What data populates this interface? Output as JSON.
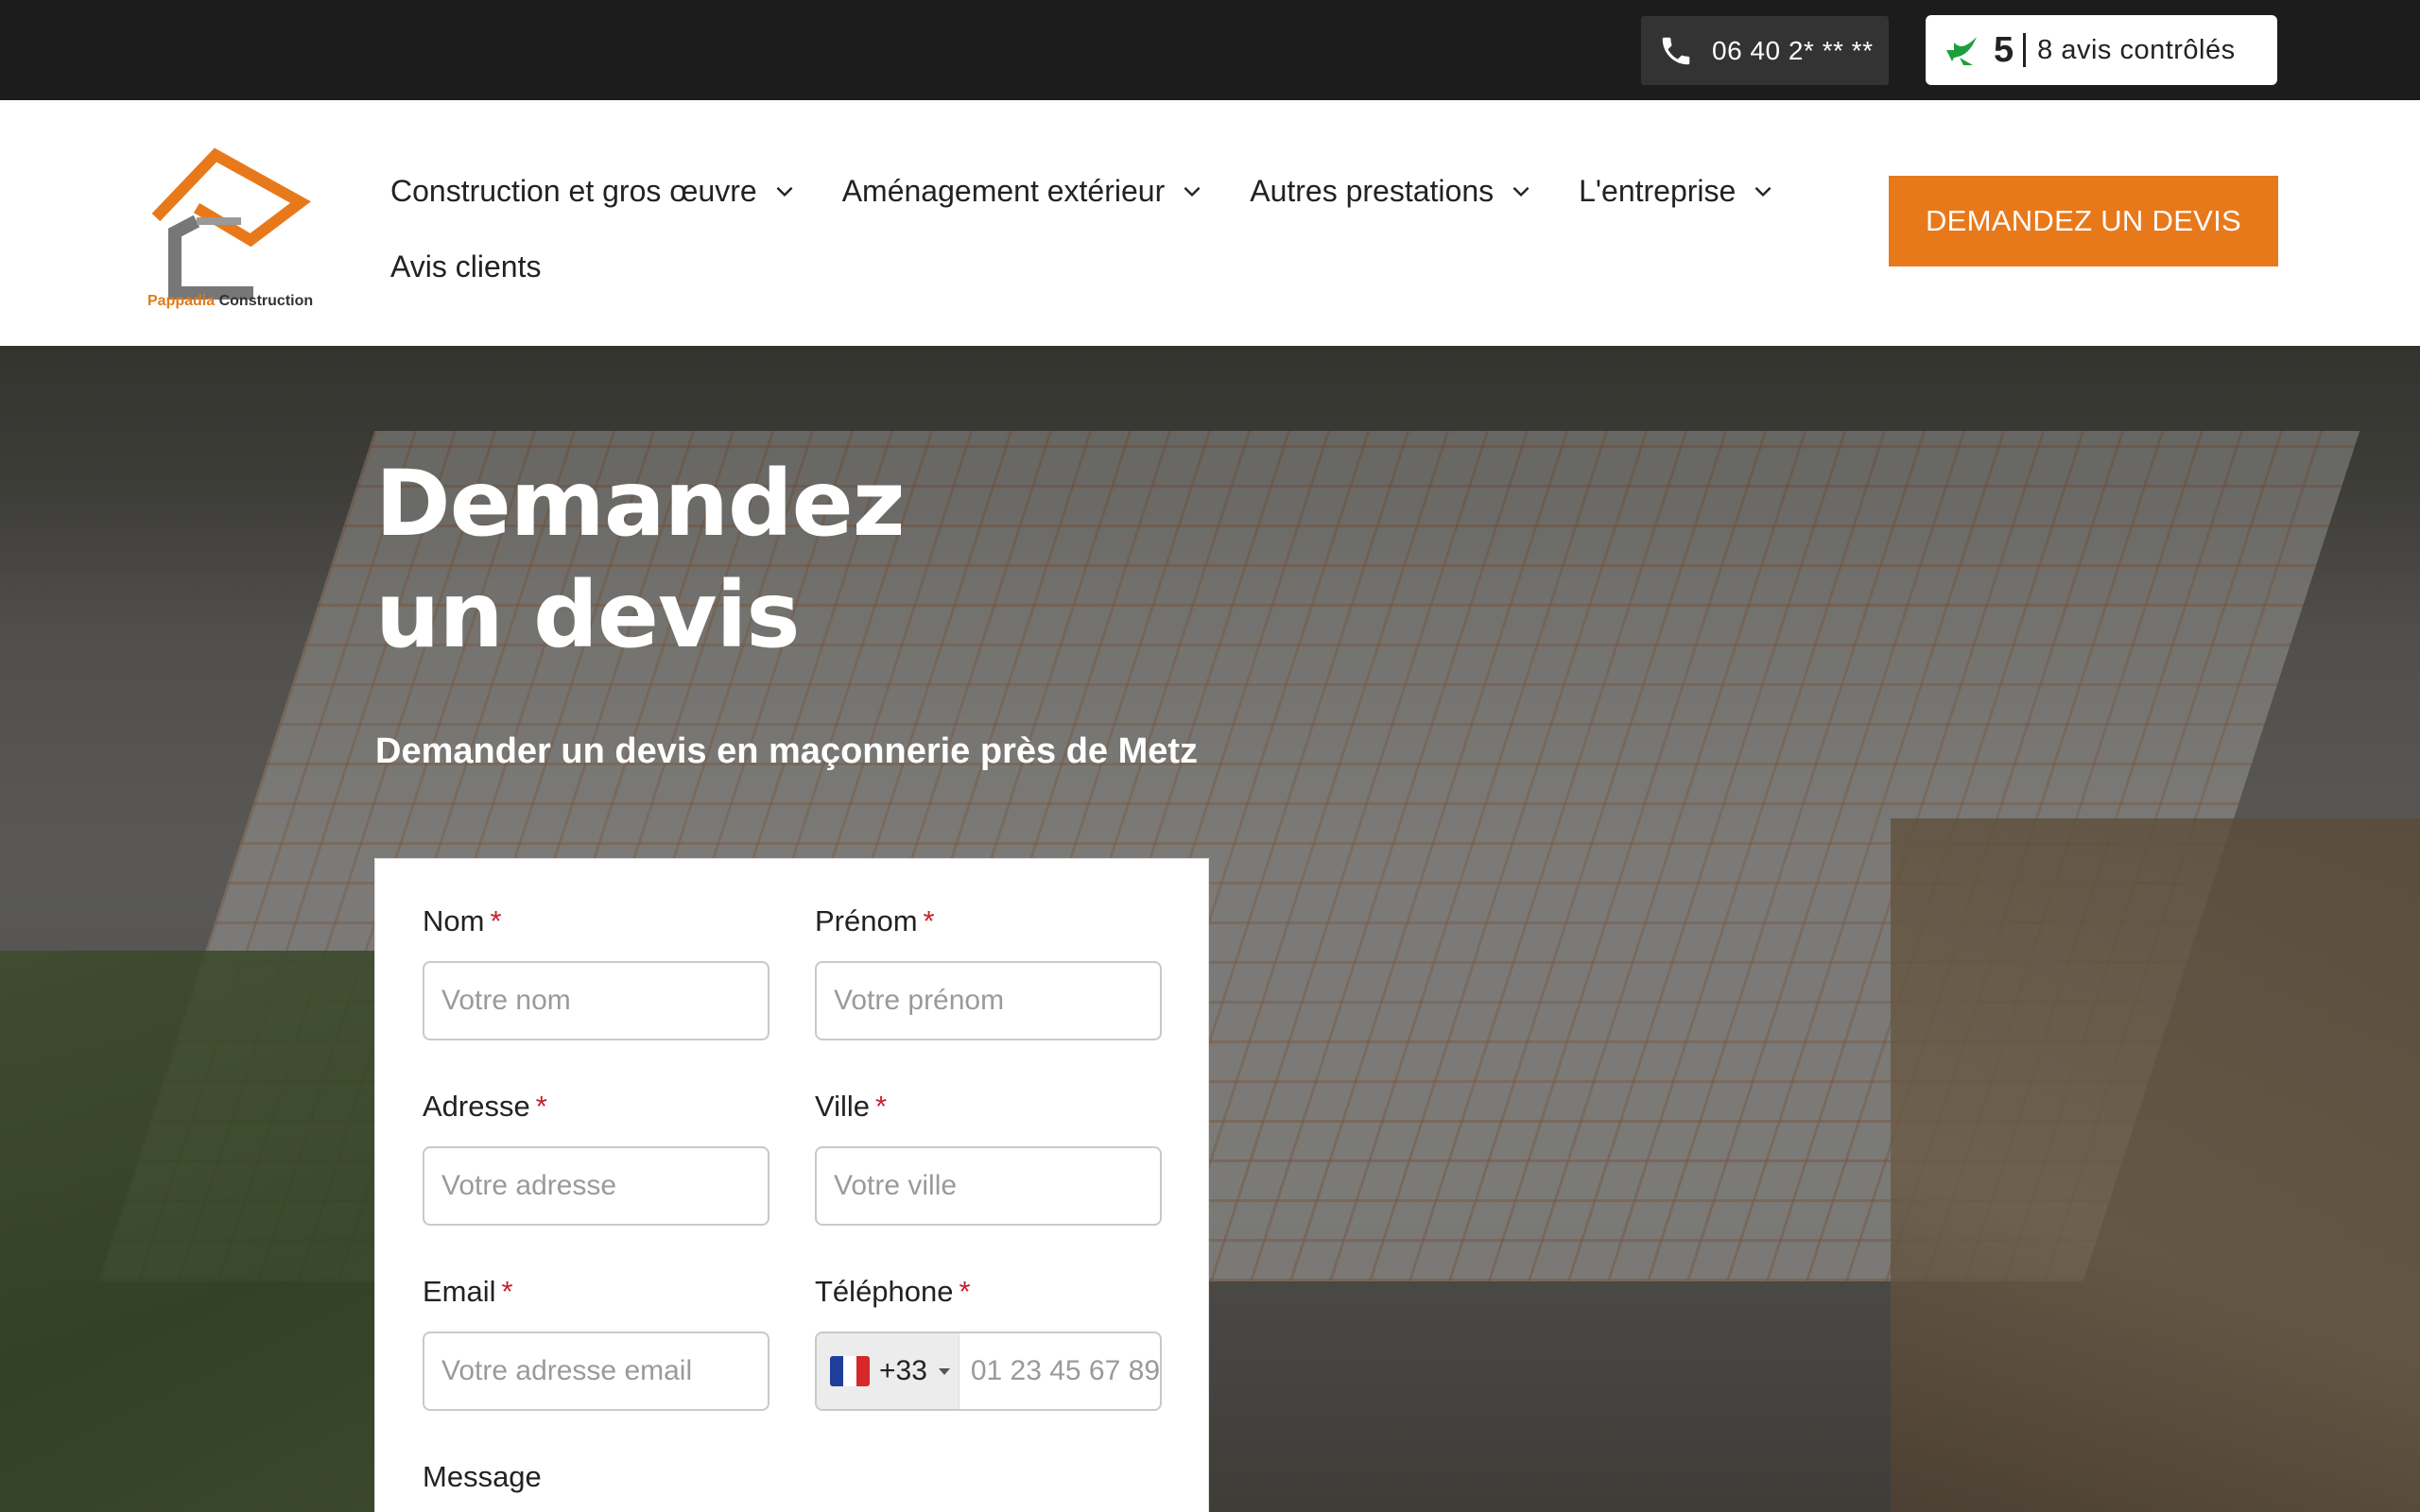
{
  "topbar": {
    "phone": "06 40 2* ** **",
    "rating_score": "5",
    "rating_count": "8 avis contrôlés"
  },
  "header": {
    "logo_text_brand": "Pappadia",
    "logo_text_rest": " Construction",
    "nav": [
      {
        "label": "Construction et gros œuvre"
      },
      {
        "label": "Aménagement extérieur"
      },
      {
        "label": "Autres prestations"
      },
      {
        "label": "L'entreprise"
      },
      {
        "label": "Avis clients"
      }
    ],
    "cta": "DEMANDEZ UN DEVIS",
    "colors": {
      "accent": "#e8791b",
      "topbar": "#1c1c1c"
    }
  },
  "hero": {
    "title": "Demandez un devis",
    "subtitle": "Demander un devis en maçonnerie près de Metz"
  },
  "form": {
    "fields": [
      {
        "label": "Nom",
        "required_mark": "*",
        "placeholder": "Votre nom"
      },
      {
        "label": "Prénom",
        "required_mark": "*",
        "placeholder": "Votre prénom"
      },
      {
        "label": "Adresse",
        "required_mark": "*",
        "placeholder": "Votre adresse"
      },
      {
        "label": "Ville",
        "required_mark": "*",
        "placeholder": "Votre ville"
      },
      {
        "label": "Email",
        "required_mark": "*",
        "placeholder": "Votre adresse email"
      },
      {
        "label": "Téléphone",
        "required_mark": "*",
        "dial_code": "+33",
        "placeholder": "01 23 45 67 89"
      }
    ],
    "message_label": "Message"
  }
}
